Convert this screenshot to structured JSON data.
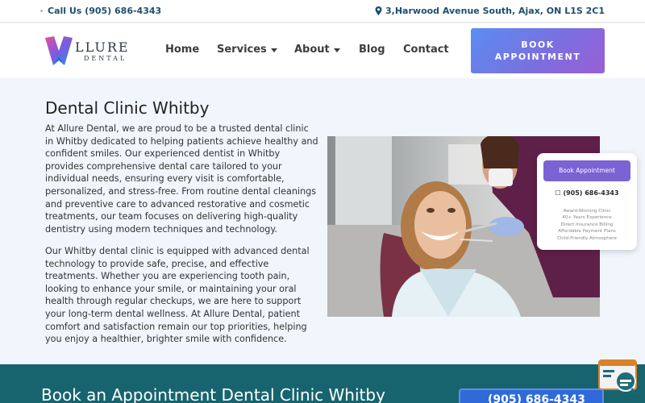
{
  "topbar": {
    "phone": "Call Us (905) 686-4343",
    "address": "3,Harwood Avenue South, Ajax, ON L1S 2C1"
  },
  "logo": {
    "name": "LLURE",
    "sub": "DENTAL"
  },
  "nav": [
    {
      "label": "Home"
    },
    {
      "label": "Services"
    },
    {
      "label": "About"
    },
    {
      "label": "Blog"
    },
    {
      "label": "Contact"
    }
  ],
  "header": {
    "book_line1": "BOOK",
    "book_line2": "APPOINTMENT"
  },
  "main": {
    "title": "Dental Clinic Whitby",
    "paragraph1": "At Allure Dental, we are proud to be a trusted dental clinic in Whitby dedicated to helping patients achieve healthy and confident smiles. Our experienced dentist in Whitby provides comprehensive dental care tailored to your individual needs, ensuring every visit is comfortable, personalized, and stress-free. From routine dental cleanings and preventive care to advanced restorative and cosmetic treatments, our team focuses on delivering high-quality dentistry using modern techniques and technology.",
    "paragraph2": "Our Whitby dental clinic is equipped with advanced dental technology to provide safe, precise, and effective treatments. Whether you are experiencing tooth pain, looking to enhance your smile, or maintaining your oral health through regular checkups, we are here to support your long-term dental wellness. At Allure Dental, patient comfort and satisfaction remain our top priorities, helping you enjoy a healthier, brighter smile with confidence."
  },
  "widget": {
    "button": "Book Appointment",
    "phone": "(905) 686-4343",
    "features": [
      "Award-Winning Clinic",
      "40+ Years Experience",
      "Direct Insurance Billing",
      "Affordable Payment Plans",
      "Child-Friendly Atmosphere"
    ]
  },
  "cta": {
    "title": "Book an Appointment Dental Clinic Whitby",
    "phone": "(905) 686-4343"
  },
  "colors": {
    "accent": "#1d4f6e",
    "cta_bg": "#18646e",
    "button_gradient_start": "#5a8ef0",
    "button_gradient_end": "#9a5fd6",
    "widget_button": "#7a63d4"
  },
  "icons": [
    "map-pin-icon",
    "chevron-down-icon",
    "phone-icon",
    "chat-support-icon"
  ]
}
